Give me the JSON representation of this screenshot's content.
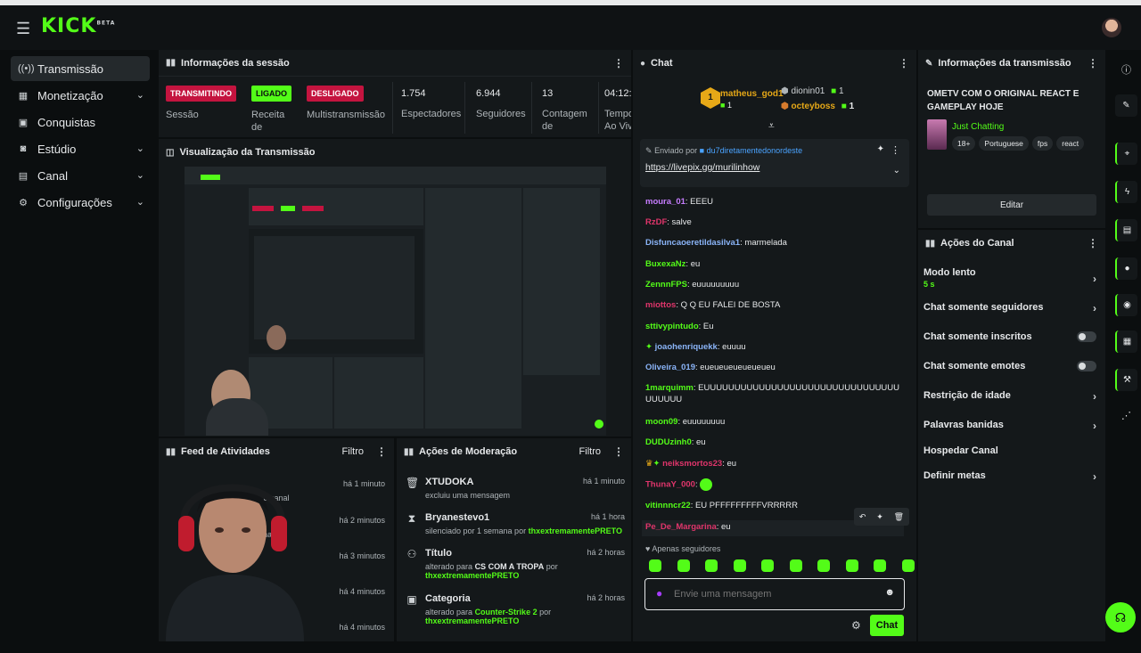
{
  "app": {
    "logo": "KICK",
    "logo_tag": "BETA"
  },
  "sidebar": {
    "items": [
      {
        "label": "Transmissão",
        "icon": "broadcast-icon",
        "active": true
      },
      {
        "label": "Monetização",
        "icon": "money-icon",
        "expandable": true
      },
      {
        "label": "Conquistas",
        "icon": "trophy-icon"
      },
      {
        "label": "Estúdio",
        "icon": "studio-icon",
        "expandable": true
      },
      {
        "label": "Canal",
        "icon": "channel-icon",
        "expandable": true
      },
      {
        "label": "Configurações",
        "icon": "gear-icon",
        "expandable": true
      }
    ]
  },
  "session": {
    "title": "Informações da sessão",
    "stats": [
      {
        "badge": "TRANSMITINDO",
        "label": "Sessão",
        "badge_color": "#c4143f"
      },
      {
        "badge": "LIGADO",
        "label": "Receita de",
        "badge_color": "#53fc18"
      },
      {
        "badge": "DESLIGADO",
        "label": "Multistransmissão",
        "badge_color": "#c4143f"
      },
      {
        "value": "1.754",
        "label": "Espectadores"
      },
      {
        "value": "6.944",
        "label": "Seguidores"
      },
      {
        "value": "13",
        "label": "Contagem de"
      },
      {
        "value": "04:12:",
        "label": "Tempo Ao Viv"
      }
    ]
  },
  "preview": {
    "title": "Visualização da Transmissão"
  },
  "feed": {
    "title": "Feed de Atividades",
    "filter": "Filtro",
    "rows": [
      {
        "time": "há 1 minuto",
        "desc": "guir o canal"
      },
      {
        "time": "há 2 minutos",
        "desc": "o canal"
      },
      {
        "time": "há 3 minutos",
        "desc": ""
      },
      {
        "time": "há 4 minutos",
        "desc": ""
      },
      {
        "time": "há 4 minutos",
        "desc": ""
      }
    ]
  },
  "moderation": {
    "title": "Ações de Moderação",
    "filter": "Filtro",
    "rows": [
      {
        "icon": "trash-icon",
        "who": "XTUDOKA",
        "what": "excluiu uma mensagem",
        "time": "há 1 minuto"
      },
      {
        "icon": "hourglass-icon",
        "who": "Bryanestevo1",
        "what": "silenciado por 1 semana por",
        "by": "thxextremamentePRETO",
        "time": "há 1 hora"
      },
      {
        "icon": "user-edit-icon",
        "who": "Título",
        "what": "alterado para",
        "target": "CS COM A TROPA",
        "por": "por",
        "by": "thxextremamentePRETO",
        "time": "há 2 horas"
      },
      {
        "icon": "category-icon",
        "who": "Categoria",
        "what": "alterado para",
        "target": "Counter-Strike 2",
        "por": "por",
        "by": "thxextremamentePRETO",
        "time": "há 2 horas"
      }
    ]
  },
  "chat": {
    "title": "Chat",
    "top_gifters": [
      {
        "name": "matheus_god1",
        "count": "1",
        "rank": "1"
      },
      {
        "name": "dionin01",
        "count": "1"
      },
      {
        "name": "octeyboss",
        "count": "1"
      }
    ],
    "pinned": {
      "sent_by_label": "Enviado por",
      "sender": "du7diretamentedonordeste",
      "link": "https://livepix.gg/murilinhow"
    },
    "messages": [
      {
        "user": "moura_01",
        "color": "#c77dff",
        "text": ": EEEU"
      },
      {
        "user": "RzDF",
        "color": "#e0356b",
        "text": ": salve"
      },
      {
        "user": "Disfuncaoeretildasilva1",
        "color": "#8ab4f8",
        "text": ": marmelada"
      },
      {
        "user": "BuxexaNz",
        "color": "#53fc18",
        "text": ": eu"
      },
      {
        "user": "ZennnFPS",
        "color": "#53fc18",
        "text": ": euuuuuuuuu"
      },
      {
        "user": "miottos",
        "color": "#e0356b",
        "text": ": Q Q EU FALEI DE BOSTA"
      },
      {
        "user": "sttivypintudo",
        "color": "#53fc18",
        "text": ": Eu"
      },
      {
        "user": "joaohenriquekk",
        "color": "#8ab4f8",
        "text": ": euuuu"
      },
      {
        "user": "Oliveira_019",
        "color": "#8ab4f8",
        "text": ": eueueueueueueueu"
      },
      {
        "user": "1marquimm",
        "color": "#53fc18",
        "text": ": EUUUUUUUUUUUUUUUUUUUUUUUUUUUUUUUUUUUUUU"
      },
      {
        "user": "moon09",
        "color": "#53fc18",
        "text": ": euuuuuuuu"
      },
      {
        "user": "DUDUzinh0",
        "color": "#53fc18",
        "text": ": eu"
      },
      {
        "user": "neiksmortos23",
        "color": "#e0356b",
        "text": ": eu"
      },
      {
        "user": "ThunaY_000",
        "color": "#e0356b",
        "text": ":"
      },
      {
        "user": "vitinnncr22",
        "color": "#53fc18",
        "text": ": EU PFFFFFFFFFVRRRRR"
      },
      {
        "user": "Pe_De_Margarina",
        "color": "#e0356b",
        "text": ": eu"
      }
    ],
    "followers_only": "Apenas seguidores",
    "input_placeholder": "Envie uma mensagem",
    "send_label": "Chat"
  },
  "stream_info": {
    "title": "Informações da transmissão",
    "stream_title": "OMETV COM O ORIGINAL REACT E GAMEPLAY HOJE",
    "category": "Just Chatting",
    "tags": [
      "18+",
      "Portuguese",
      "fps",
      "react"
    ],
    "edit_label": "Editar"
  },
  "channel_actions": {
    "title": "Ações do Canal",
    "items": [
      {
        "label": "Modo lento",
        "sub": "5 s",
        "kind": "arrow"
      },
      {
        "label": "Chat somente seguidores",
        "kind": "arrow"
      },
      {
        "label": "Chat somente inscritos",
        "kind": "toggle"
      },
      {
        "label": "Chat somente emotes",
        "kind": "toggle"
      },
      {
        "label": "Restrição de idade",
        "kind": "arrow"
      },
      {
        "label": "Palavras banidas",
        "kind": "arrow"
      },
      {
        "label": "Hospedar Canal",
        "kind": "none"
      },
      {
        "label": "Definir metas",
        "kind": "arrow"
      }
    ]
  },
  "colors": {
    "accent": "#53fc18",
    "live": "#c4143f",
    "panel": "#14181a"
  }
}
